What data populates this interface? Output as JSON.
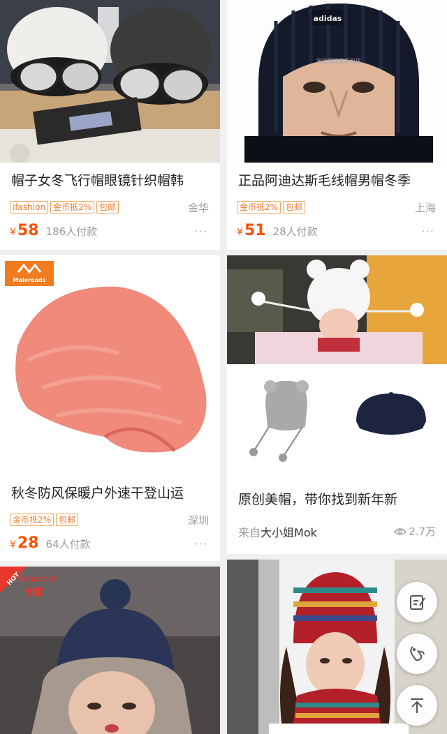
{
  "products": [
    {
      "title": "帽子女冬飞行帽眼镜针织帽韩",
      "tags": [
        "ifashion",
        "金币抵2%",
        "包邮"
      ],
      "location": "金华",
      "currency": "¥",
      "price": "58",
      "paid": "186人付款",
      "more": "···"
    },
    {
      "title": "正品阿迪达斯毛线帽男帽冬季",
      "tags": [
        "金币抵2%",
        "包邮"
      ],
      "location": "上海",
      "currency": "¥",
      "price": "51",
      "paid": "28人付款",
      "more": "···",
      "brand_text": "adidas",
      "watermark": "淘宝帽正品折扣店"
    },
    {
      "title": "秋冬防风保暖户外速干登山运",
      "tags": [
        "金币抵2%",
        "包邮"
      ],
      "location": "深圳",
      "currency": "¥",
      "price": "28",
      "paid": "64人付款",
      "more": "···",
      "brand_text": "Maleroads"
    },
    {
      "brand_text": "Kenmont",
      "brand_cn": "卡蒙",
      "hot_label": "HOT"
    }
  ],
  "article": {
    "title": "原创美帽，带你找到新年新",
    "source_prefix": "来自",
    "source_name": "大小姐Mok",
    "views": "2.7万"
  },
  "fabs": [
    {
      "icon": "edit-note-icon"
    },
    {
      "icon": "wardrobe-icon"
    },
    {
      "icon": "back-to-top-icon"
    }
  ]
}
